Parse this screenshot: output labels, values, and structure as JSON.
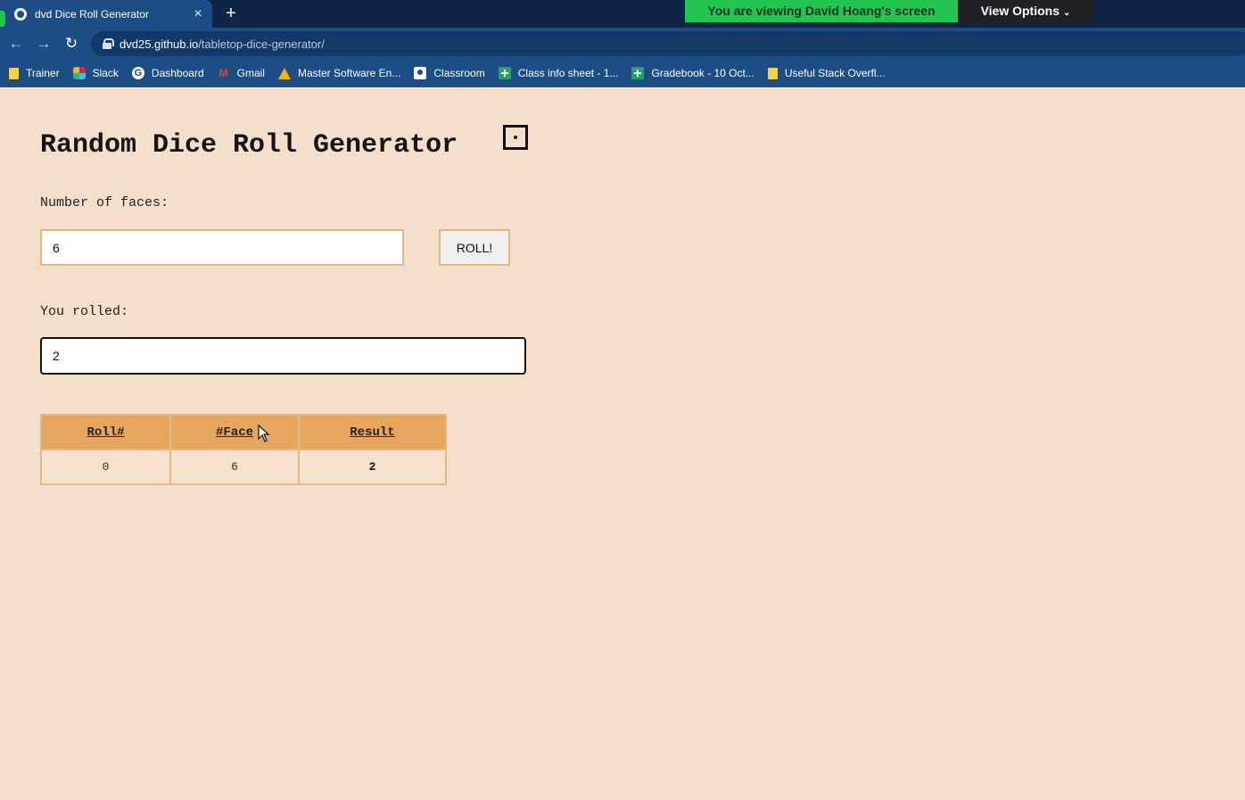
{
  "browser": {
    "tab_title": "dvd Dice Roll Generator",
    "tab_close": "×",
    "new_tab": "+",
    "url_host": "dvd25.github.io",
    "url_path": "/tabletop-dice-generator/",
    "share_banner": "You are viewing David Hoang's screen",
    "view_options": "View Options",
    "bookmarks": [
      {
        "label": "Trainer",
        "icon": "folder-icon"
      },
      {
        "label": "Slack",
        "icon": "slack-icon"
      },
      {
        "label": "Dashboard",
        "icon": "google-icon"
      },
      {
        "label": "Gmail",
        "icon": "gmail-icon"
      },
      {
        "label": "Master Software En...",
        "icon": "drive-icon"
      },
      {
        "label": "Classroom",
        "icon": "classroom-icon"
      },
      {
        "label": "Class info sheet - 1...",
        "icon": "sheets-icon"
      },
      {
        "label": "Gradebook - 10 Oct...",
        "icon": "sheets-icon"
      },
      {
        "label": "Useful Stack Overfl...",
        "icon": "folder-icon"
      }
    ]
  },
  "app": {
    "title": "Random Dice Roll Generator",
    "faces_label": "Number of faces:",
    "faces_value": "6",
    "roll_button": "ROLL!",
    "result_label": "You rolled:",
    "result_value": "2",
    "table": {
      "headers": [
        "Roll#",
        "#Face",
        "Result"
      ],
      "rows": [
        [
          "0",
          "6",
          "2"
        ]
      ]
    }
  },
  "colors": {
    "page_bg": "#f3dfca",
    "header_bg": "#e7a65d",
    "border": "#e2b88a",
    "share_green": "#23c552",
    "chrome_blue": "#1c4d85"
  }
}
